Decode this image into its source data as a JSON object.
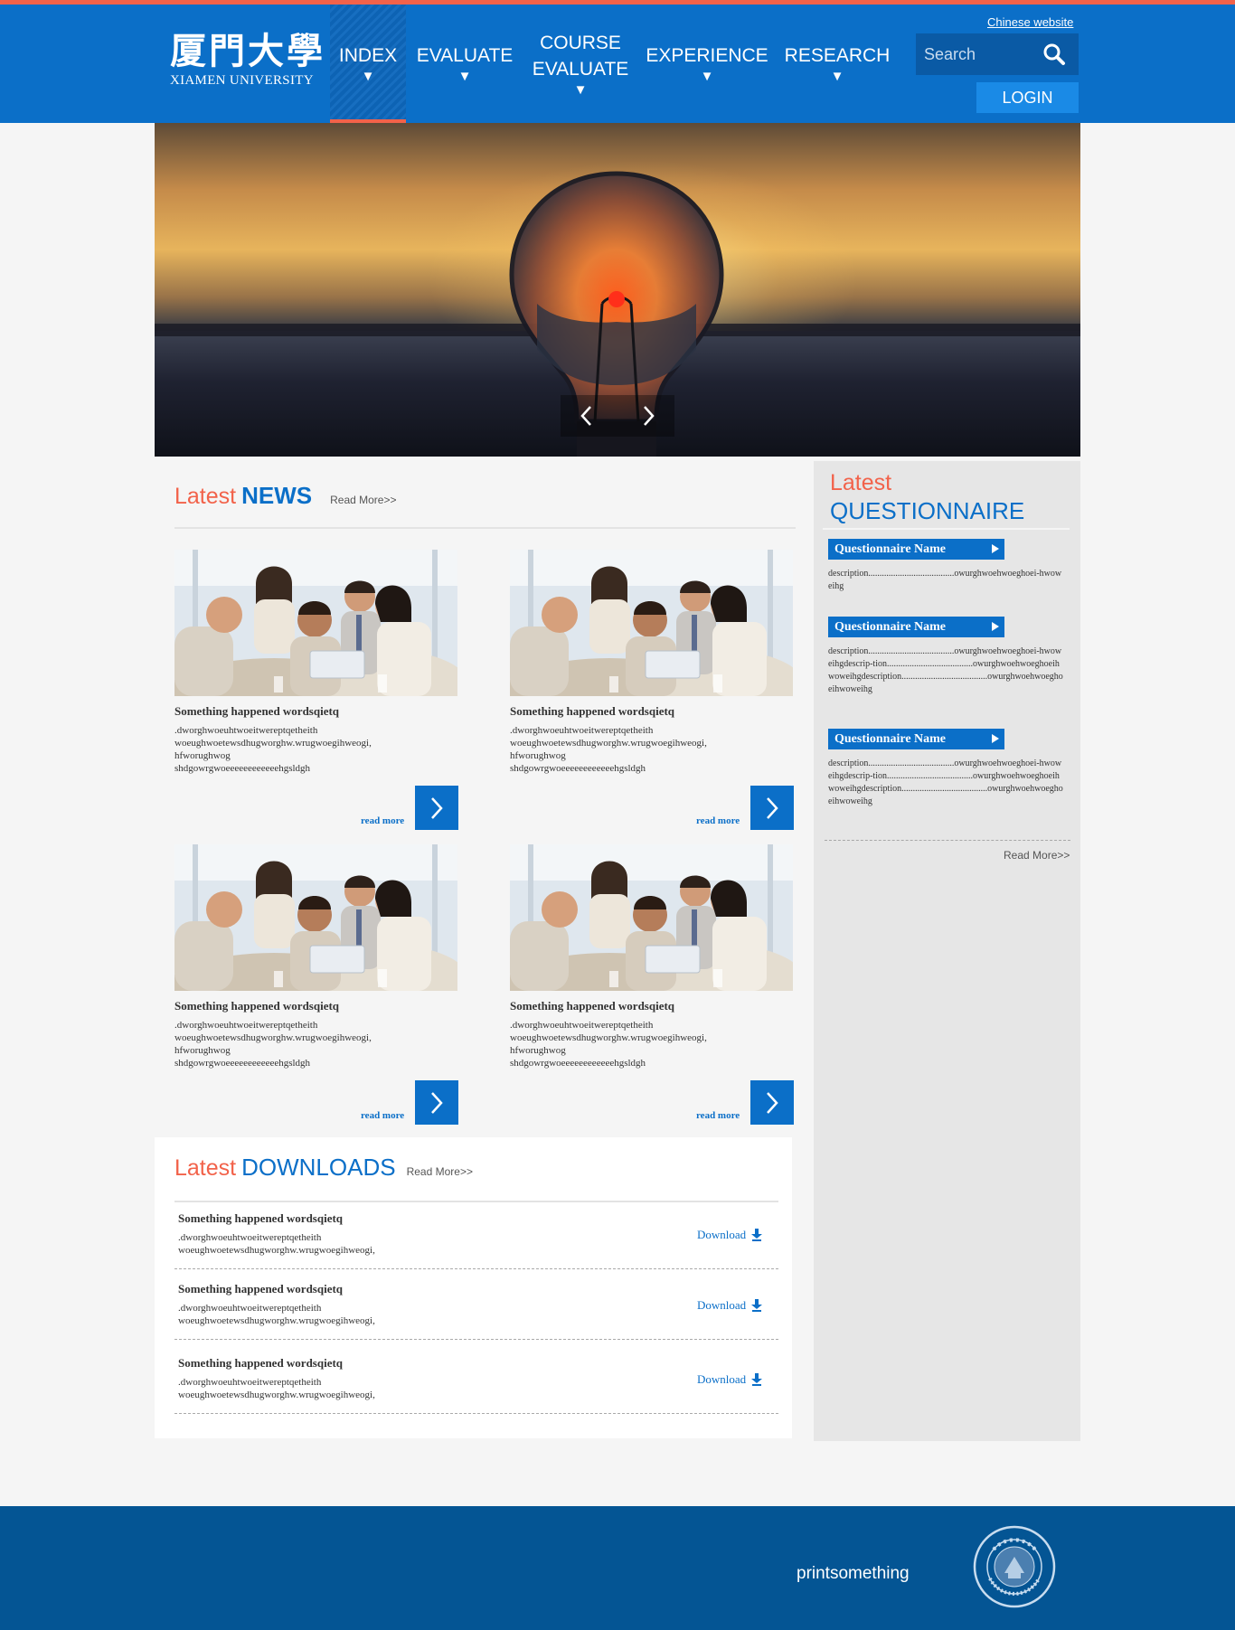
{
  "header": {
    "logo_cn": "厦門大學",
    "logo_en": "XIAMEN UNIVERSITY",
    "chinese_link": "Chinese website",
    "search_placeholder": "Search",
    "login": "LOGIN",
    "nav": [
      {
        "label": "INDEX",
        "active": true
      },
      {
        "label": "EVALUATE"
      },
      {
        "label": "COURSE EVALUATE"
      },
      {
        "label": "EXPERIENCE"
      },
      {
        "label": "RESEARCH"
      }
    ],
    "colors": {
      "primary": "#0b6fc8",
      "accent": "#f2624a",
      "footer": "#045594"
    }
  },
  "news": {
    "title_a": "Latest",
    "title_b": "NEWS",
    "more": "Read More>>",
    "items": [
      {
        "title": "Something happened wordsqietq",
        "desc_1": ".dworghwoeuhtwoeitwereptqetheith",
        "desc_2": "woeughwoetewsdhugworghw.wrugwoegihweogi,",
        "desc_3": "hfworughwog",
        "desc_4": "shdgowrgwoeeeeeeeeeeeehgsldgh",
        "read": "read more"
      },
      {
        "title": "Something happened wordsqietq",
        "desc_1": ".dworghwoeuhtwoeitwereptqetheith",
        "desc_2": "woeughwoetewsdhugworghw.wrugwoegihweogi,",
        "desc_3": "hfworughwog",
        "desc_4": "shdgowrgwoeeeeeeeeeeeehgsldgh",
        "read": "read more"
      },
      {
        "title": "Something happened wordsqietq",
        "desc_1": ".dworghwoeuhtwoeitwereptqetheith",
        "desc_2": "woeughwoetewsdhugworghw.wrugwoegihweogi,",
        "desc_3": "hfworughwog",
        "desc_4": "shdgowrgwoeeeeeeeeeeeehgsldgh",
        "read": "read more"
      },
      {
        "title": "Something happened wordsqietq",
        "desc_1": ".dworghwoeuhtwoeitwereptqetheith",
        "desc_2": "woeughwoetewsdhugworghw.wrugwoegihweogi,",
        "desc_3": "hfworughwog",
        "desc_4": "shdgowrgwoeeeeeeeeeeeehgsldgh",
        "read": "read more"
      }
    ]
  },
  "downloads": {
    "title_a": "Latest",
    "title_b": "DOWNLOADS",
    "more": "Read More>>",
    "items": [
      {
        "title": "Something happened wordsqietq",
        "desc_1": ".dworghwoeuhtwoeitwereptqetheith",
        "desc_2": "woeughwoetewsdhugworghw.wrugwoegihweogi,",
        "button": "Download"
      },
      {
        "title": "Something happened wordsqietq",
        "desc_1": ".dworghwoeuhtwoeitwereptqetheith",
        "desc_2": "woeughwoetewsdhugworghw.wrugwoegihweogi,",
        "button": "Download"
      },
      {
        "title": "Something happened wordsqietq",
        "desc_1": ".dworghwoeuhtwoeitwereptqetheith",
        "desc_2": "woeughwoetewsdhugworghw.wrugwoegihweogi,",
        "button": "Download"
      }
    ]
  },
  "questionnaire": {
    "title_a": "Latest",
    "title_b": "QUESTIONNAIRE",
    "more": "Read More>>",
    "items": [
      {
        "name": "Questionnaire Name",
        "desc": "description......................................owurghwoehwoeghoei-hwoweihg"
      },
      {
        "name": "Questionnaire Name",
        "desc": "description......................................owurghwoehwoeghoei-hwoweihgdescrip-tion......................................owurghwoehwoeghoeihwoweihgdescription......................................owurghwoehwoeghoeihwoweihg"
      },
      {
        "name": "Questionnaire Name",
        "desc": "description......................................owurghwoehwoeghoei-hwoweihgdescrip-tion......................................owurghwoehwoeghoeihwoweihgdescription......................................owurghwoehwoeghoeihwoweihg"
      }
    ]
  },
  "footer": {
    "text": "printsomething",
    "seal_text": "UNIVERSITAS AMOIENSIS"
  }
}
